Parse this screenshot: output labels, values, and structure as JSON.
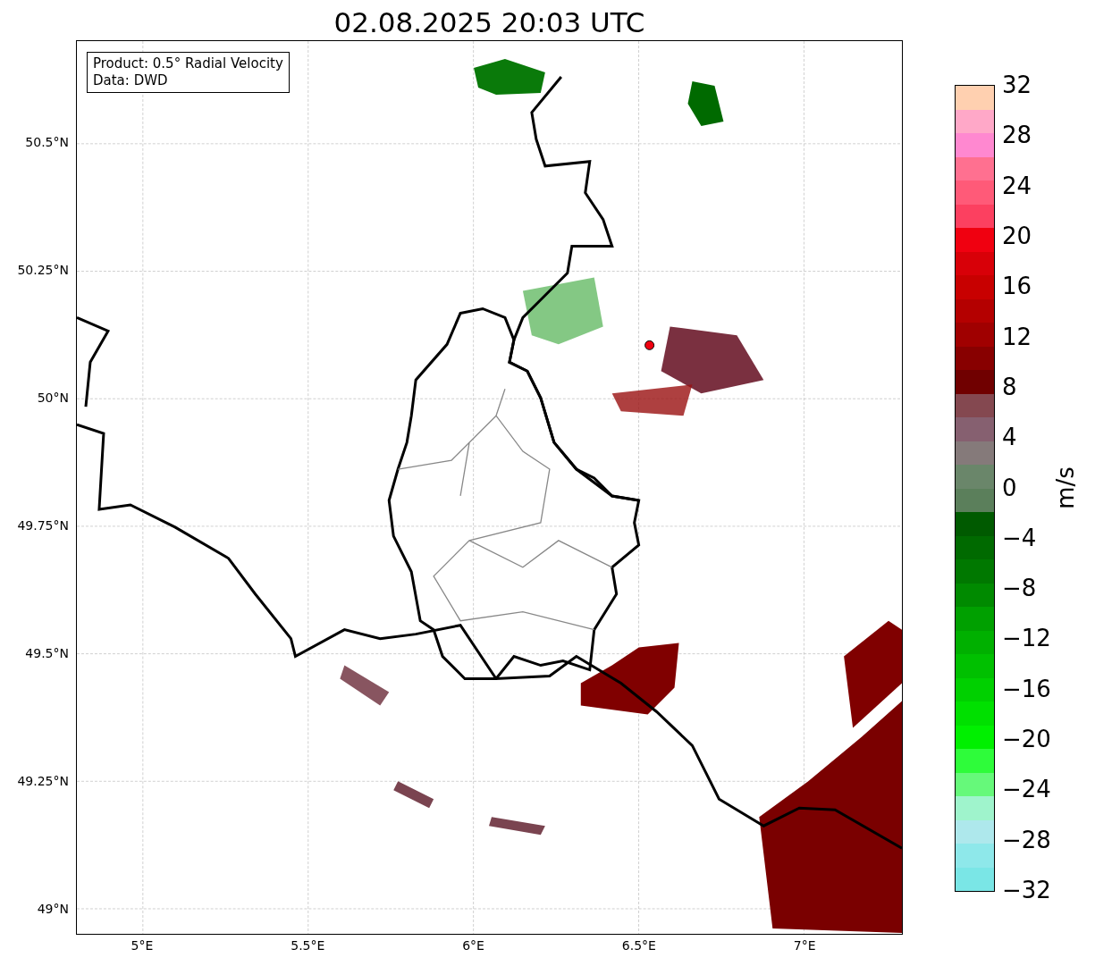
{
  "title": "02.08.2025 20:03 UTC",
  "legend": {
    "lines": [
      "Product: 0.5° Radial Velocity",
      "Data: DWD"
    ]
  },
  "map": {
    "xticks": [
      "5°E",
      "5.5°E",
      "6°E",
      "6.5°E",
      "7°E"
    ],
    "yticks": [
      "50.5°N",
      "50.25°N",
      "50°N",
      "49.75°N",
      "49.5°N",
      "49.25°N",
      "49°N"
    ]
  },
  "colorbar": {
    "label": "m/s",
    "ticks": [
      "32",
      "28",
      "24",
      "20",
      "16",
      "12",
      "8",
      "4",
      "0",
      "−4",
      "−8",
      "−12",
      "−16",
      "−20",
      "−24",
      "−28",
      "−32"
    ],
    "bins": [
      {
        "color": "#7ae6e6"
      },
      {
        "color": "#8ee8ea"
      },
      {
        "color": "#aee8ec"
      },
      {
        "color": "#9ff4cc"
      },
      {
        "color": "#66f97a"
      },
      {
        "color": "#2efc3a"
      },
      {
        "color": "#00f000"
      },
      {
        "color": "#00e000"
      },
      {
        "color": "#00d000"
      },
      {
        "color": "#00c000"
      },
      {
        "color": "#00b000"
      },
      {
        "color": "#00a000"
      },
      {
        "color": "#008a00"
      },
      {
        "color": "#007800"
      },
      {
        "color": "#006a00"
      },
      {
        "color": "#005a00"
      },
      {
        "color": "#5b7f5b"
      },
      {
        "color": "#6a866a"
      },
      {
        "color": "#857a7a"
      },
      {
        "color": "#866070"
      },
      {
        "color": "#844850"
      },
      {
        "color": "#700000"
      },
      {
        "color": "#880000"
      },
      {
        "color": "#a00000"
      },
      {
        "color": "#b40000"
      },
      {
        "color": "#c80000"
      },
      {
        "color": "#d80008"
      },
      {
        "color": "#f00010"
      },
      {
        "color": "#fc4060"
      },
      {
        "color": "#ff5a78"
      },
      {
        "color": "#ff7090"
      },
      {
        "color": "#ff88d0"
      },
      {
        "color": "#ffa8c8"
      },
      {
        "color": "#ffd0b0"
      }
    ]
  }
}
